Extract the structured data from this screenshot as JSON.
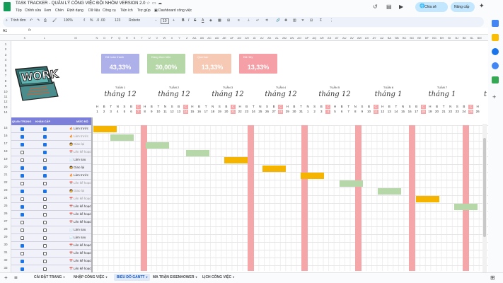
{
  "doc": {
    "title": "TASK TRACKER - QUẢN LÝ CÔNG VIỆC ĐỘI NHÓM VERSION 2.0",
    "menu": [
      "Tệp",
      "Chỉnh sửa",
      "Xem",
      "Chèn",
      "Định dạng",
      "Dữ liệu",
      "Công cụ",
      "Tiện ích",
      "Trợ giúp"
    ],
    "dashboard_link": "Dashboard công việc",
    "share_label": "Chia sẻ",
    "upgrade_label": "Nâng cấp"
  },
  "toolbar": {
    "menus_label": "Trình đơn",
    "zoom": "100%",
    "currency": "₫",
    "percent": "%",
    "decimals": ".0 .00",
    "number_format": "123",
    "font": "Roboto",
    "font_size": "10"
  },
  "formula_bar": {
    "cell_ref": "A1"
  },
  "column_letters": [
    "K",
    "L",
    "M",
    "N",
    "O",
    "P",
    "Q",
    "R",
    "S",
    "T",
    "U",
    "V",
    "W",
    "X",
    "Y",
    "Z",
    "AA",
    "AB",
    "AC",
    "AD",
    "AE",
    "AF",
    "AG",
    "AH",
    "AI",
    "AJ",
    "AK",
    "AL",
    "AM",
    "AN",
    "AO",
    "AP",
    "AQ",
    "AR",
    "AS",
    "AT",
    "AU",
    "AV",
    "AW",
    "AX",
    "AY",
    "AZ",
    "BA",
    "BB",
    "BC",
    "BD",
    "BE",
    "BF",
    "BG",
    "BH",
    "BI",
    "BJ",
    "BK",
    "BL",
    "BM"
  ],
  "row_numbers": [
    "1",
    "2",
    "3",
    "4",
    "5",
    "6",
    "7",
    "8",
    "9",
    "10",
    "11",
    "12",
    "13",
    "14",
    "15",
    "16",
    "17",
    "18",
    "19",
    "20",
    "21",
    "22",
    "23",
    "24",
    "25",
    "26",
    "27",
    "28",
    "29",
    "30",
    "31",
    "32",
    "33",
    "34",
    "35"
  ],
  "stats": [
    {
      "label": "Đã hoàn thành",
      "value": "43,33%",
      "color": "#aeb0ea"
    },
    {
      "label": "Đang thực hiện",
      "value": "30,00%",
      "color": "#b6d7a8"
    },
    {
      "label": "Quá hạn",
      "value": "13,33%",
      "color": "#f5c9b3"
    },
    {
      "label": "Đã Hủy",
      "value": "13,33%",
      "color": "#f4a0a6"
    }
  ],
  "weeks": [
    {
      "label": "TUẦN 1",
      "month": "tháng 12"
    },
    {
      "label": "TUẦN 2",
      "month": "tháng 12"
    },
    {
      "label": "TUẦN 3",
      "month": "tháng 12"
    },
    {
      "label": "TUẦN 4",
      "month": "tháng 12"
    },
    {
      "label": "TUẦN 5",
      "month": "tháng 12"
    },
    {
      "label": "TUẦN 6",
      "month": "tháng 1"
    },
    {
      "label": "TUẦN 7",
      "month": "tháng 1"
    }
  ],
  "weekday_letters": [
    "H",
    "B",
    "T",
    "N",
    "S",
    "B",
    "C",
    "H",
    "B",
    "T",
    "N",
    "S",
    "B",
    "C",
    "H",
    "B",
    "T",
    "N",
    "S",
    "B",
    "C",
    "H",
    "B",
    "T",
    "N",
    "S",
    "B",
    "C",
    "H",
    "B",
    "T",
    "N",
    "S",
    "B",
    "C",
    "H",
    "B",
    "T",
    "N",
    "S",
    "B",
    "C",
    "H",
    "B",
    "T",
    "N",
    "S",
    "B",
    "C",
    "H",
    "B",
    "T",
    "N",
    "S",
    "B",
    "C",
    "H"
  ],
  "dates": [
    "1",
    "2",
    "3",
    "4",
    "5",
    "6",
    "7",
    "8",
    "9",
    "10",
    "11",
    "12",
    "13",
    "14",
    "15",
    "16",
    "17",
    "18",
    "19",
    "20",
    "21",
    "22",
    "23",
    "24",
    "25",
    "26",
    "27",
    "28",
    "29",
    "30",
    "31",
    "1",
    "2",
    "3",
    "4",
    "5",
    "6",
    "7",
    "8",
    "9",
    "10",
    "11",
    "12",
    "13",
    "14",
    "15",
    "16",
    "17",
    "18",
    "19",
    "20",
    "21",
    "22",
    "23",
    "24",
    "25",
    "26"
  ],
  "table_headers": {
    "important": "QUAN TRỌNG",
    "urgent": "KHẨN CẤP",
    "level": "MỨC ĐỘ"
  },
  "rows": [
    {
      "imp": true,
      "urg": true,
      "status": "Làm trước",
      "icon": "🔥",
      "muted": false
    },
    {
      "imp": true,
      "urg": true,
      "status": "Làm trước",
      "icon": "🔥",
      "muted": true
    },
    {
      "imp": true,
      "urg": true,
      "status": "Giao lại",
      "icon": "🧑",
      "muted": true
    },
    {
      "imp": false,
      "urg": true,
      "status": "Lên kế hoạch",
      "icon": "📅",
      "muted": true
    },
    {
      "imp": false,
      "urg": false,
      "status": "Làm sau",
      "icon": "🧾",
      "muted": false
    },
    {
      "imp": true,
      "urg": true,
      "status": "Giao lại",
      "icon": "🧑",
      "muted": false
    },
    {
      "imp": true,
      "urg": true,
      "status": "Làm trước",
      "icon": "🔥",
      "muted": false
    },
    {
      "imp": false,
      "urg": false,
      "status": "Lên kế hoạch",
      "icon": "📅",
      "muted": true
    },
    {
      "imp": true,
      "urg": true,
      "status": "Giao lại",
      "icon": "🧑",
      "muted": true
    },
    {
      "imp": false,
      "urg": false,
      "status": "Lên kế hoạch",
      "icon": "📅",
      "muted": true
    },
    {
      "imp": true,
      "urg": false,
      "status": "Lên kế hoạch",
      "icon": "📅",
      "muted": false
    },
    {
      "imp": true,
      "urg": false,
      "status": "Lên kế hoạch",
      "icon": "📅",
      "muted": false
    },
    {
      "imp": false,
      "urg": false,
      "status": "Lên kế hoạch",
      "icon": "📅",
      "muted": false
    },
    {
      "imp": false,
      "urg": false,
      "status": "Làm sau",
      "icon": "🧾",
      "muted": false
    },
    {
      "imp": false,
      "urg": false,
      "status": "Làm sau",
      "icon": "🧾",
      "muted": false
    },
    {
      "imp": true,
      "urg": false,
      "status": "Lên kế hoạch",
      "icon": "📅",
      "muted": false
    },
    {
      "imp": false,
      "urg": false,
      "status": "Lên kế hoạch",
      "icon": "📅",
      "muted": false
    },
    {
      "imp": true,
      "urg": false,
      "status": "Lên kế hoạch",
      "icon": "📅",
      "muted": false
    },
    {
      "imp": true,
      "urg": false,
      "status": "Lên kế hoạch",
      "icon": "📅",
      "muted": false
    }
  ],
  "gantt_bars": [
    {
      "start": 1,
      "days": 4,
      "color": "#f4b400"
    },
    {
      "start": 4,
      "days": 4,
      "color": "#b6d7a8"
    },
    {
      "start": 11,
      "days": 4,
      "color": "#b6d7a8"
    },
    {
      "start": 18,
      "days": 4,
      "color": "#b6d7a8"
    },
    {
      "start": 25,
      "days": 4,
      "color": "#f4b400"
    },
    {
      "start": 32,
      "days": 4,
      "color": "#f4b400"
    },
    {
      "start": 39,
      "days": 4,
      "color": "#f4b400"
    },
    {
      "start": 46,
      "days": 4,
      "color": "#b6d7a8"
    },
    {
      "start": 53,
      "days": 4,
      "color": "#b6d7a8"
    },
    {
      "start": 60,
      "days": 4,
      "color": "#f4b400"
    },
    {
      "start": 67,
      "days": 4,
      "color": "#b6d7a8"
    }
  ],
  "sheet_tabs": [
    "CÀI ĐẶT TRANG",
    "NHẬP CÔNG VIỆC",
    "BIỂU ĐỒ GANTT",
    "MA TRẬN EISENHOWER",
    "LỊCH CÔNG VIỆC"
  ],
  "active_tab": "BIỂU ĐỒ GANTT",
  "logo_text": "WORK"
}
